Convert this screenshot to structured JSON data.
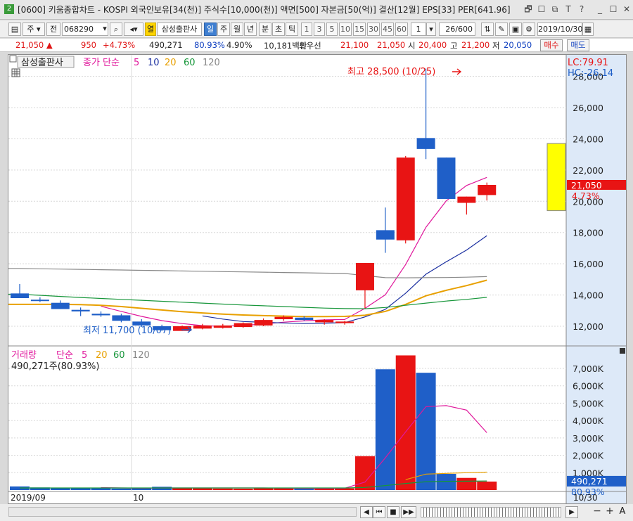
{
  "window": {
    "badge": "2",
    "title": "[0600] 키움종합차트 - KOSPI 외국인보유[34(천)] 주식수[10,000(천)] 액면[500] 자본금[50(억)] 결산[12월] EPS[33] PER[641.96]",
    "buttons": [
      "🗗",
      "☐",
      "⧉",
      "T",
      "?",
      "_",
      "☐",
      "✕"
    ]
  },
  "toolbar": {
    "mode_select": "주",
    "period_select": "전",
    "code": "068290",
    "stock_name": "삼성출판사",
    "yellow_tag": "열",
    "period_tabs": [
      "일",
      "주",
      "월",
      "년",
      "분",
      "초",
      "틱"
    ],
    "active_period": "일",
    "minute_options": [
      "1",
      "3",
      "5",
      "10",
      "15",
      "30",
      "45",
      "60"
    ],
    "unit": "1",
    "count": "26/600",
    "date": "2019/10/30"
  },
  "quote": {
    "price": "21,050",
    "arrow": "▲",
    "change": "950",
    "change_pct": "+4.73%",
    "volume": "490,271",
    "vol_ratio": "80.93%",
    "turnover": "4.90%",
    "amount": "10,181백만",
    "bid_label": "최우선",
    "ask_price": "21,100",
    "bid_price": "21,050",
    "open_label": "시",
    "open": "20,400",
    "high_label": "고",
    "high": "21,200",
    "low_label": "저",
    "low": "20,050",
    "buy_button": "매수",
    "sell_button": "매도"
  },
  "chart_data": [
    {
      "type": "candlestick",
      "title": "삼성출판사",
      "legend": {
        "label": "종가 단순",
        "periods": [
          "5",
          "10",
          "20",
          "60",
          "120"
        ],
        "colors": [
          "#e0189c",
          "#1b2fa0",
          "#e8a000",
          "#17963a",
          "#888888"
        ]
      },
      "corner_labels": [
        "LC:79.91",
        "HC:-26.14"
      ],
      "annotations": {
        "high": "최고 28,500 (10/25)",
        "low": "최저 11,700 (10/07)"
      },
      "current": {
        "price": "21,050",
        "pct": "4.73%"
      },
      "yticks": [
        "12,000",
        "14,000",
        "16,000",
        "18,000",
        "20,000",
        "22,000",
        "24,000",
        "26,000",
        "28,000"
      ],
      "ylim": [
        11000,
        29000
      ],
      "colors": {
        "up": "#e81414",
        "down": "#1f5fc8"
      },
      "candles": [
        {
          "o": 14100,
          "h": 14700,
          "l": 13800,
          "c": 13800
        },
        {
          "o": 13700,
          "h": 13850,
          "l": 13550,
          "c": 13650
        },
        {
          "o": 13500,
          "h": 13650,
          "l": 13100,
          "c": 13100
        },
        {
          "o": 13050,
          "h": 13200,
          "l": 12650,
          "c": 12950
        },
        {
          "o": 12800,
          "h": 12950,
          "l": 12600,
          "c": 12700
        },
        {
          "o": 12700,
          "h": 12800,
          "l": 12250,
          "c": 12350
        },
        {
          "o": 12300,
          "h": 12450,
          "l": 11950,
          "c": 12050
        },
        {
          "o": 12000,
          "h": 12100,
          "l": 11700,
          "c": 11750
        },
        {
          "o": 11700,
          "h": 12050,
          "l": 11700,
          "c": 12000
        },
        {
          "o": 11850,
          "h": 12150,
          "l": 11800,
          "c": 12050
        },
        {
          "o": 11900,
          "h": 12150,
          "l": 11850,
          "c": 12050
        },
        {
          "o": 11950,
          "h": 12250,
          "l": 11900,
          "c": 12200
        },
        {
          "o": 12050,
          "h": 12500,
          "l": 12000,
          "c": 12400
        },
        {
          "o": 12450,
          "h": 12700,
          "l": 12350,
          "c": 12600
        },
        {
          "o": 12550,
          "h": 12650,
          "l": 12350,
          "c": 12400
        },
        {
          "o": 12250,
          "h": 12450,
          "l": 12100,
          "c": 12400
        },
        {
          "o": 12200,
          "h": 12350,
          "l": 12100,
          "c": 12300
        },
        {
          "o": 14300,
          "h": 16050,
          "l": 13150,
          "c": 16050
        },
        {
          "o": 18150,
          "h": 19600,
          "l": 16700,
          "c": 17550
        },
        {
          "o": 17500,
          "h": 22900,
          "l": 17300,
          "c": 22800
        },
        {
          "o": 24050,
          "h": 28500,
          "l": 22700,
          "c": 23350
        },
        {
          "o": 22800,
          "h": 22800,
          "l": 20150,
          "c": 20150
        },
        {
          "o": 19900,
          "h": 20300,
          "l": 19150,
          "c": 20300
        },
        {
          "o": 20400,
          "h": 21200,
          "l": 20050,
          "c": 21050
        }
      ],
      "ma": [
        {
          "period": "5",
          "color": "#e0189c",
          "values": [
            null,
            null,
            null,
            null,
            13280,
            12950,
            12630,
            12360,
            12170,
            12040,
            11990,
            12060,
            12140,
            12260,
            12340,
            12410,
            12430,
            13150,
            14010,
            15950,
            18340,
            20030,
            21010,
            21530
          ]
        },
        {
          "period": "10",
          "color": "#1b2fa0",
          "values": [
            null,
            null,
            null,
            null,
            null,
            null,
            null,
            null,
            null,
            12660,
            12460,
            12300,
            12250,
            12210,
            12170,
            12200,
            12230,
            12600,
            13080,
            14110,
            15330,
            16130,
            16880,
            17800
          ]
        },
        {
          "period": "20",
          "color": "#e8a000",
          "values": [
            13400,
            13400,
            13400,
            13380,
            13340,
            13260,
            13150,
            13040,
            12930,
            12850,
            12780,
            12720,
            12680,
            12650,
            12620,
            12620,
            12630,
            12700,
            12950,
            13400,
            13950,
            14300,
            14600,
            14950
          ]
        },
        {
          "period": "60",
          "color": "#17963a",
          "values": [
            14050,
            13980,
            13910,
            13840,
            13780,
            13720,
            13660,
            13600,
            13540,
            13480,
            13420,
            13360,
            13310,
            13260,
            13210,
            13160,
            13130,
            13120,
            13200,
            13340,
            13480,
            13610,
            13720,
            13850
          ]
        },
        {
          "period": "120",
          "color": "#888888",
          "values": [
            15700,
            15680,
            15660,
            15640,
            15620,
            15600,
            15580,
            15560,
            15540,
            15520,
            15500,
            15480,
            15460,
            15440,
            15420,
            15400,
            15380,
            15240,
            15110,
            15100,
            15110,
            15120,
            15140,
            15180
          ]
        }
      ]
    },
    {
      "type": "bar",
      "title": "거래량",
      "legend": {
        "label": "단순",
        "periods": [
          "5",
          "20",
          "60",
          "120"
        ],
        "colors": [
          "#e0189c",
          "#e8a000",
          "#17963a",
          "#888888"
        ]
      },
      "info": "490,271주(80.93%)",
      "current": {
        "value": "490,271",
        "pct": "80.93%"
      },
      "yticks": [
        "1,000K",
        "2,000K",
        "3,000K",
        "4,000K",
        "5,000K",
        "6,000K",
        "7,000K"
      ],
      "ylim": [
        0,
        7800
      ],
      "unit": "K",
      "values": [
        210,
        150,
        130,
        120,
        100,
        90,
        110,
        190,
        130,
        100,
        90,
        80,
        100,
        100,
        80,
        90,
        100,
        1950,
        6950,
        7750,
        6750,
        930,
        700,
        490
      ],
      "ma5": [
        null,
        null,
        null,
        null,
        140,
        120,
        110,
        120,
        120,
        120,
        120,
        120,
        120,
        110,
        90,
        90,
        100,
        460,
        1850,
        3350,
        4800,
        4860,
        4600,
        3300
      ],
      "ma20": [
        null,
        null,
        null,
        null,
        null,
        null,
        null,
        null,
        null,
        null,
        null,
        null,
        null,
        null,
        null,
        null,
        null,
        null,
        null,
        600,
        920,
        960,
        1000,
        1030
      ],
      "ma60": [
        120,
        120,
        120,
        120,
        120,
        120,
        120,
        120,
        120,
        120,
        120,
        120,
        120,
        120,
        120,
        120,
        120,
        150,
        260,
        380,
        480,
        500,
        510,
        520
      ],
      "x_labels": [
        "2019/09",
        "10",
        "10/30"
      ]
    }
  ],
  "statusbar": {
    "buttons": [
      "◀",
      "▶",
      "⏮",
      "■",
      "▶▶"
    ],
    "zoom": [
      "−",
      "+",
      "A"
    ]
  }
}
